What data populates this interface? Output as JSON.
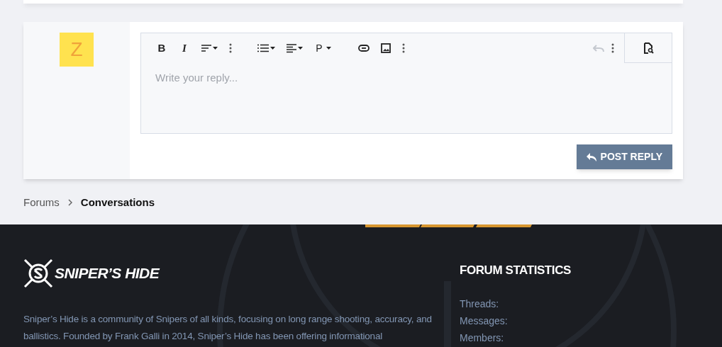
{
  "reply_form": {
    "avatar_letter": "Z",
    "toolbar": [
      {
        "kind": "bold",
        "label": "B"
      },
      {
        "kind": "italic",
        "label": "I"
      },
      {
        "kind": "align-menu"
      },
      {
        "kind": "more"
      },
      {
        "kind": "gap"
      },
      {
        "kind": "list-menu"
      },
      {
        "kind": "paragraph-align-menu"
      },
      {
        "kind": "paragraph-menu",
        "label": "P"
      },
      {
        "kind": "gap"
      },
      {
        "kind": "link"
      },
      {
        "kind": "image"
      },
      {
        "kind": "more"
      }
    ],
    "undo": {
      "disabled": true
    },
    "placeholder": "Write your reply...",
    "submit": "POST REPLY"
  },
  "breadcrumb": [
    {
      "label": "Forums",
      "current": false
    },
    {
      "label": "Conversations",
      "current": true
    }
  ],
  "footer": {
    "logo_text": "SNIPER’S HIDE",
    "description": "Sniper’s Hide is a community of Snipers of all kinds, focusing on long range shooting, accuracy, and ballistics. Founded by Frank Galli in 2014, Sniper’s Hide has been offering informational",
    "stats_title": "FORUM STATISTICS",
    "stats": [
      "Threads:",
      "Messages:",
      "Members:"
    ]
  }
}
